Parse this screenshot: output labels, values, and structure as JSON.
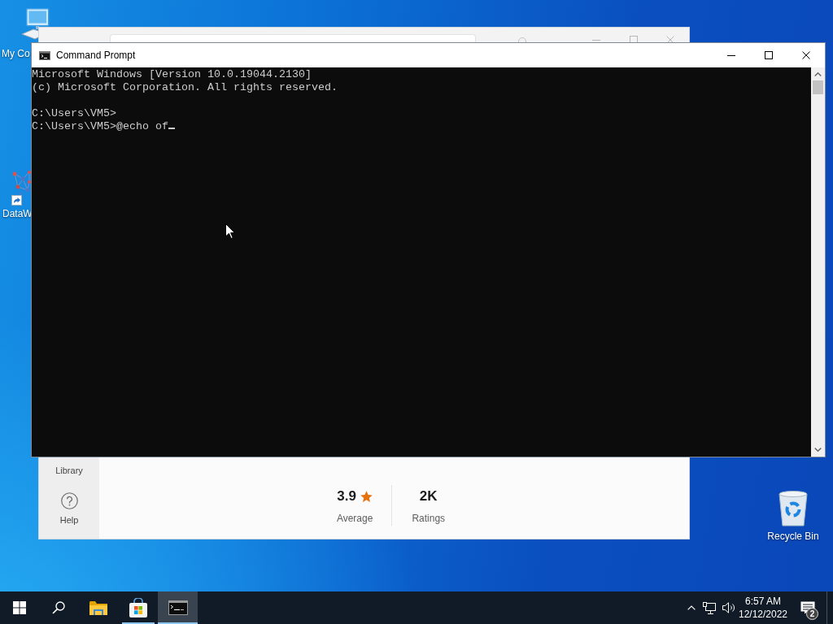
{
  "desktop_icons": [
    {
      "kind": "computer",
      "label": "My Co"
    },
    {
      "kind": "shortcut",
      "label": "DataW"
    },
    {
      "kind": "recycle",
      "label": "Recycle Bin"
    }
  ],
  "store_window": {
    "sidebar": [
      {
        "kind": "label",
        "label": "Library"
      },
      {
        "kind": "help",
        "label": "Help"
      }
    ],
    "rating_summary": {
      "average": "3.9",
      "average_label": "Average",
      "count": "2K",
      "count_label": "Ratings"
    }
  },
  "console_window": {
    "title": "Command Prompt",
    "blocks": [
      [
        "Microsoft Windows [Version 10.0.19044.2130]",
        "(c) Microsoft Corporation. All rights reserved."
      ],
      [
        "C:\\Users\\VM5>",
        "C:\\Users\\VM5>@echo of"
      ]
    ]
  },
  "taskbar": {
    "apps": [
      {
        "kind": "folder",
        "running": false,
        "selected": false
      },
      {
        "kind": "store",
        "running": true,
        "selected": false
      },
      {
        "kind": "console",
        "running": true,
        "selected": true
      }
    ],
    "time": "6:57 AM",
    "date": "12/12/2022",
    "notification_count": "2"
  }
}
